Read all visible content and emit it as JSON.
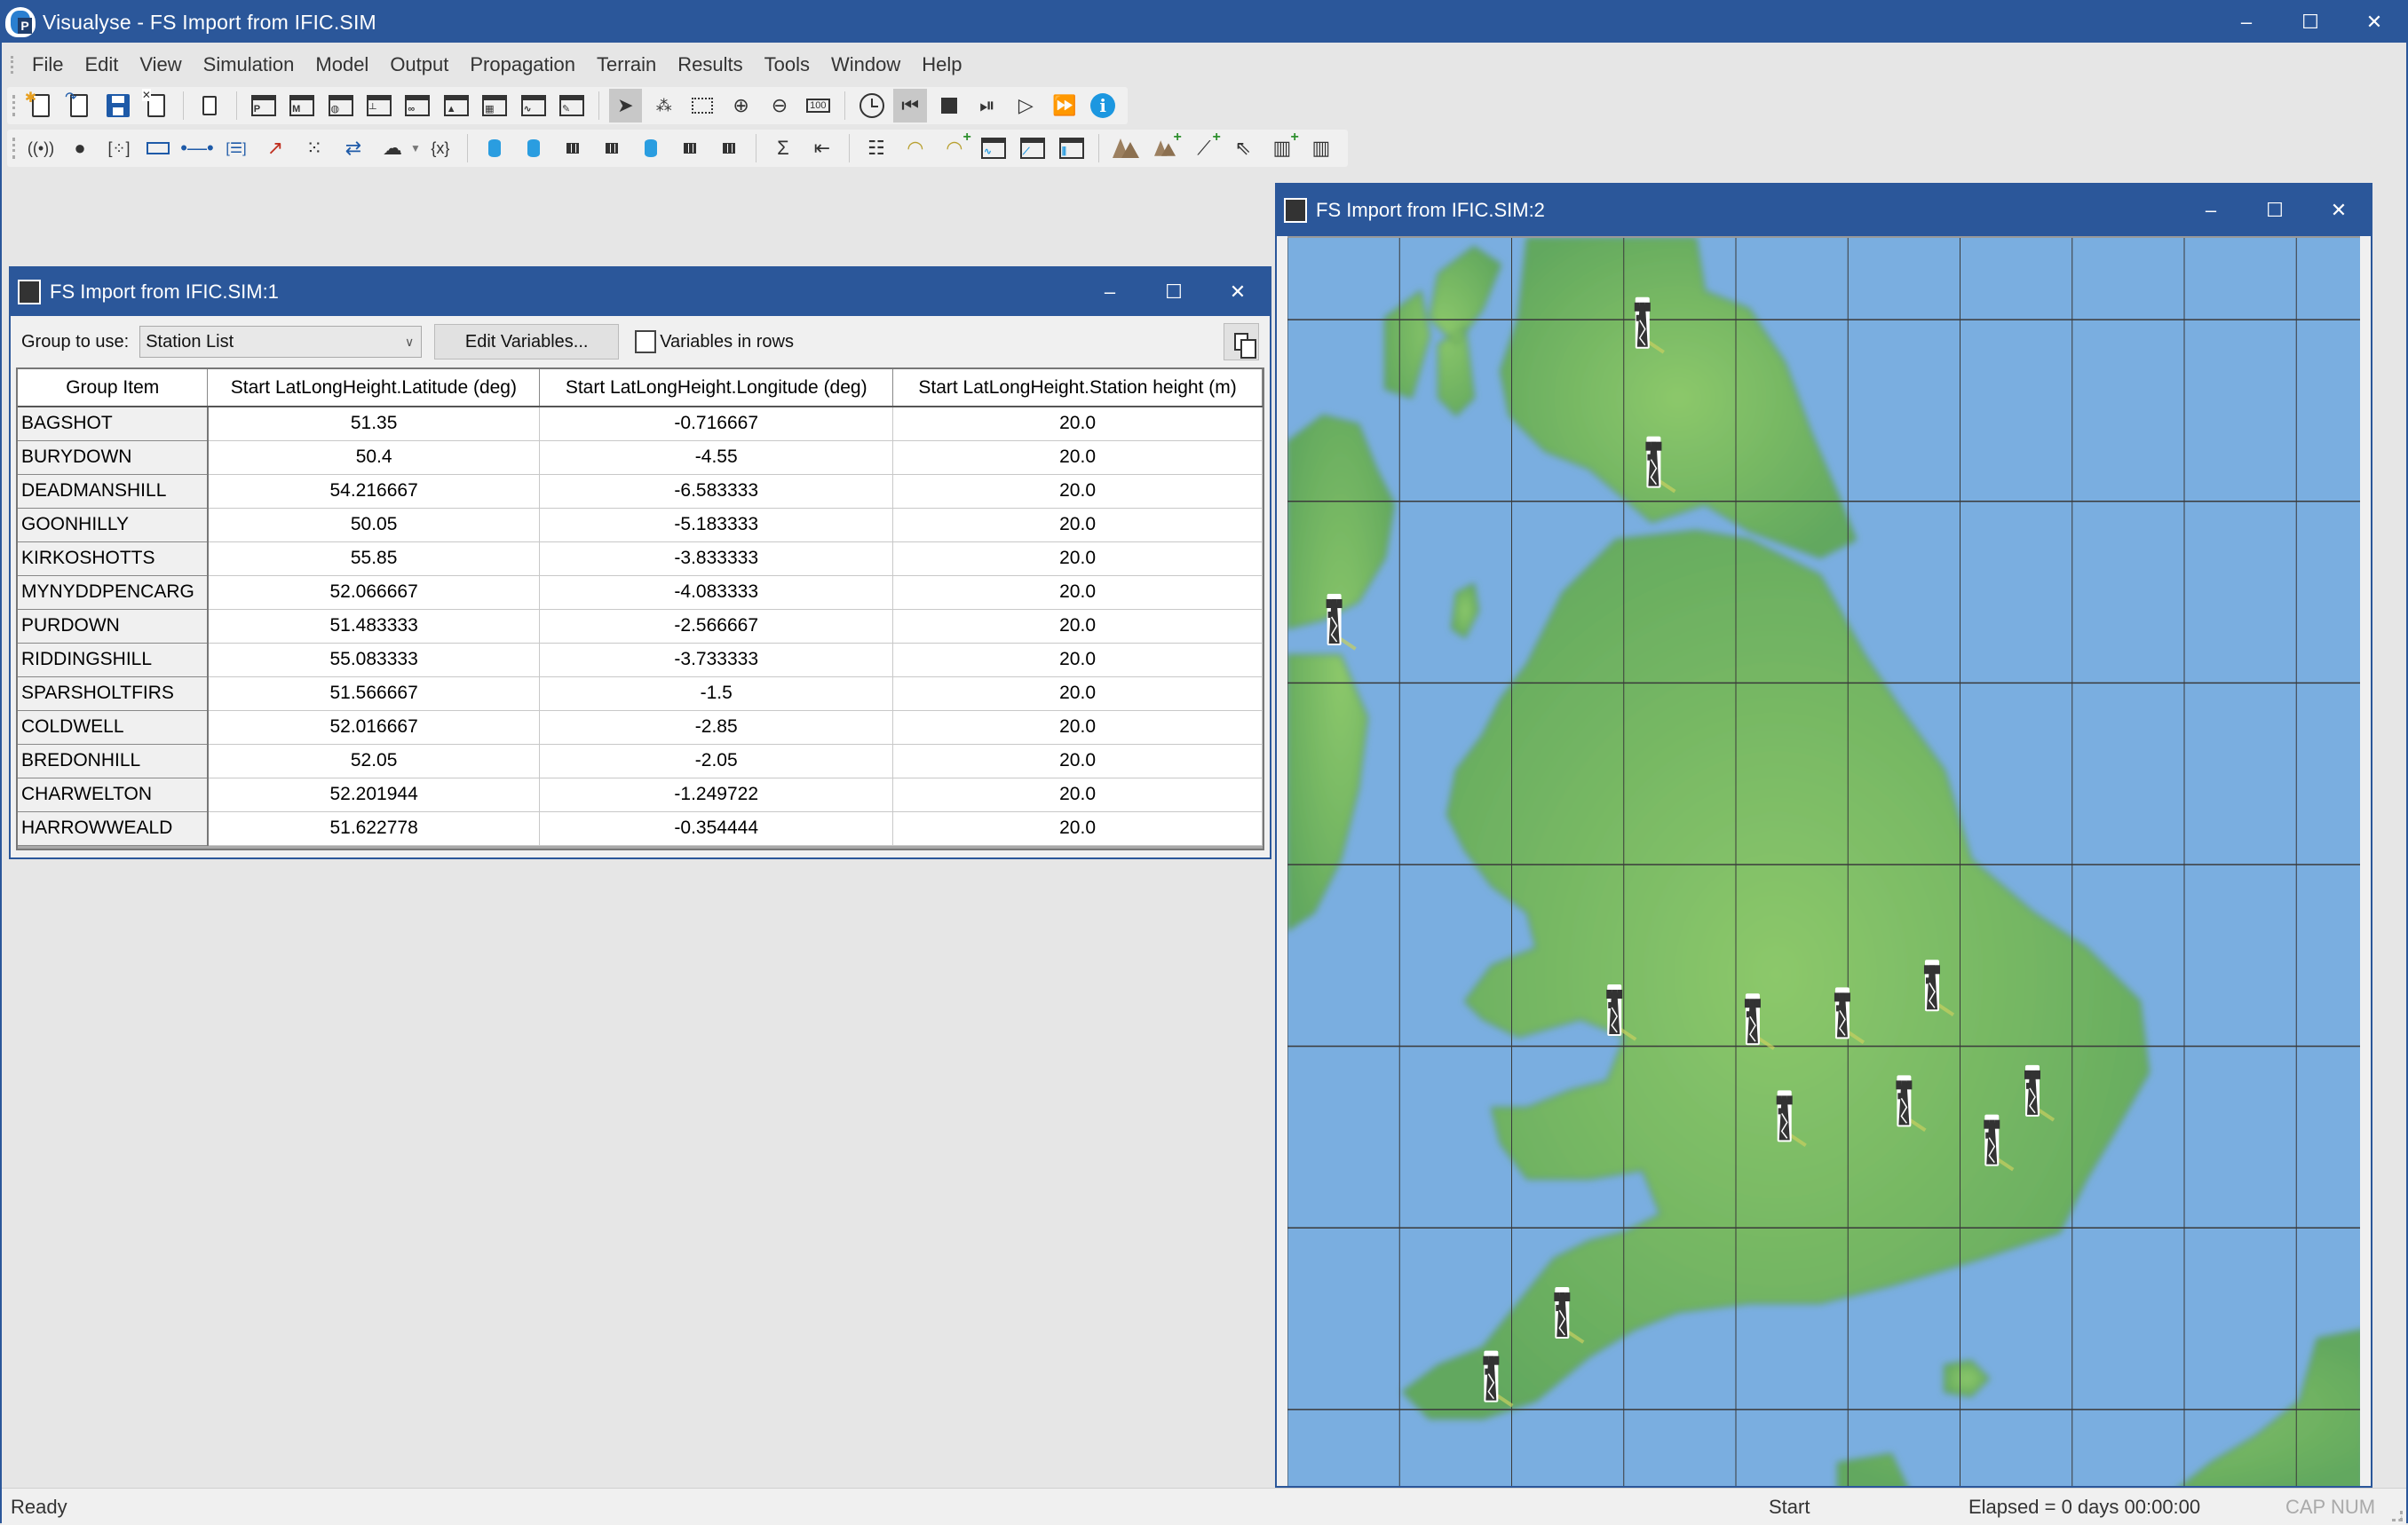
{
  "app": {
    "title": "Visualyse - FS Import from IFIC.SIM",
    "controls": {
      "minimize": "–",
      "maximize": "☐",
      "close": "✕"
    }
  },
  "menu": [
    "File",
    "Edit",
    "View",
    "Simulation",
    "Model",
    "Output",
    "Propagation",
    "Terrain",
    "Results",
    "Tools",
    "Window",
    "Help"
  ],
  "toolbar1": {
    "groups": [
      [
        "new-file-icon",
        "open-file-icon",
        "save-icon",
        "close-file-icon"
      ],
      [
        "copy-icon"
      ],
      [
        "project-window-icon",
        "model-window-icon",
        "globe-window-icon",
        "hierarchy-window-icon",
        "view-window-icon",
        "terrain-window-icon",
        "table-window-icon",
        "graph-window-icon",
        "tools-window-icon"
      ],
      [
        "select-pointer-icon",
        "select-point-icon",
        "select-rect-icon",
        "zoom-in-icon",
        "zoom-out-icon",
        "zoom-100-icon"
      ],
      [
        "clock-icon",
        "rewind-start-icon",
        "stop-icon",
        "step-icon",
        "play-icon",
        "fast-forward-icon",
        "info-icon"
      ]
    ],
    "zoom_100_label": "100"
  },
  "toolbar2": {
    "variables_label": "{x}",
    "sum_label": "Σ"
  },
  "window1": {
    "title": "FS Import from IFIC.SIM:1",
    "group_label": "Group to use:",
    "group_value": "Station List",
    "edit_variables_label": "Edit Variables...",
    "variables_in_rows_label": "Variables in rows",
    "variables_in_rows_checked": false,
    "columns": [
      "Group Item",
      "Start LatLongHeight.Latitude (deg)",
      "Start LatLongHeight.Longitude (deg)",
      "Start LatLongHeight.Station height (m)"
    ],
    "rows": [
      [
        "BAGSHOT",
        "51.35",
        "-0.716667",
        "20.0"
      ],
      [
        "BURYDOWN",
        "50.4",
        "-4.55",
        "20.0"
      ],
      [
        "DEADMANSHILL",
        "54.216667",
        "-6.583333",
        "20.0"
      ],
      [
        "GOONHILLY",
        "50.05",
        "-5.183333",
        "20.0"
      ],
      [
        "KIRKOSHOTTS",
        "55.85",
        "-3.833333",
        "20.0"
      ],
      [
        "MYNYDDPENCARG",
        "52.066667",
        "-4.083333",
        "20.0"
      ],
      [
        "PURDOWN",
        "51.483333",
        "-2.566667",
        "20.0"
      ],
      [
        "RIDDINGSHILL",
        "55.083333",
        "-3.733333",
        "20.0"
      ],
      [
        "SPARSHOLTFIRS",
        "51.566667",
        "-1.5",
        "20.0"
      ],
      [
        "COLDWELL",
        "52.016667",
        "-2.85",
        "20.0"
      ],
      [
        "BREDONHILL",
        "52.05",
        "-2.05",
        "20.0"
      ],
      [
        "CHARWELTON",
        "52.201944",
        "-1.249722",
        "20.0"
      ],
      [
        "HARROWWEALD",
        "51.622778",
        "-0.354444",
        "20.0"
      ]
    ]
  },
  "window2": {
    "title": "FS Import from IFIC.SIM:2",
    "map": {
      "land_color": "#6fb368",
      "sea_color": "#7aaee0",
      "grid_color": "#3a3a3a",
      "station_icon": "radio-tower-icon",
      "station_count": 13
    }
  },
  "statusbar": {
    "ready": "Ready",
    "start": "Start",
    "elapsed": "Elapsed = 0 days 00:00:00",
    "caps": "CAP NUM"
  },
  "colors": {
    "titlebar": "#2b579a",
    "info": "#1c97e0",
    "save": "#1e5aa8"
  }
}
